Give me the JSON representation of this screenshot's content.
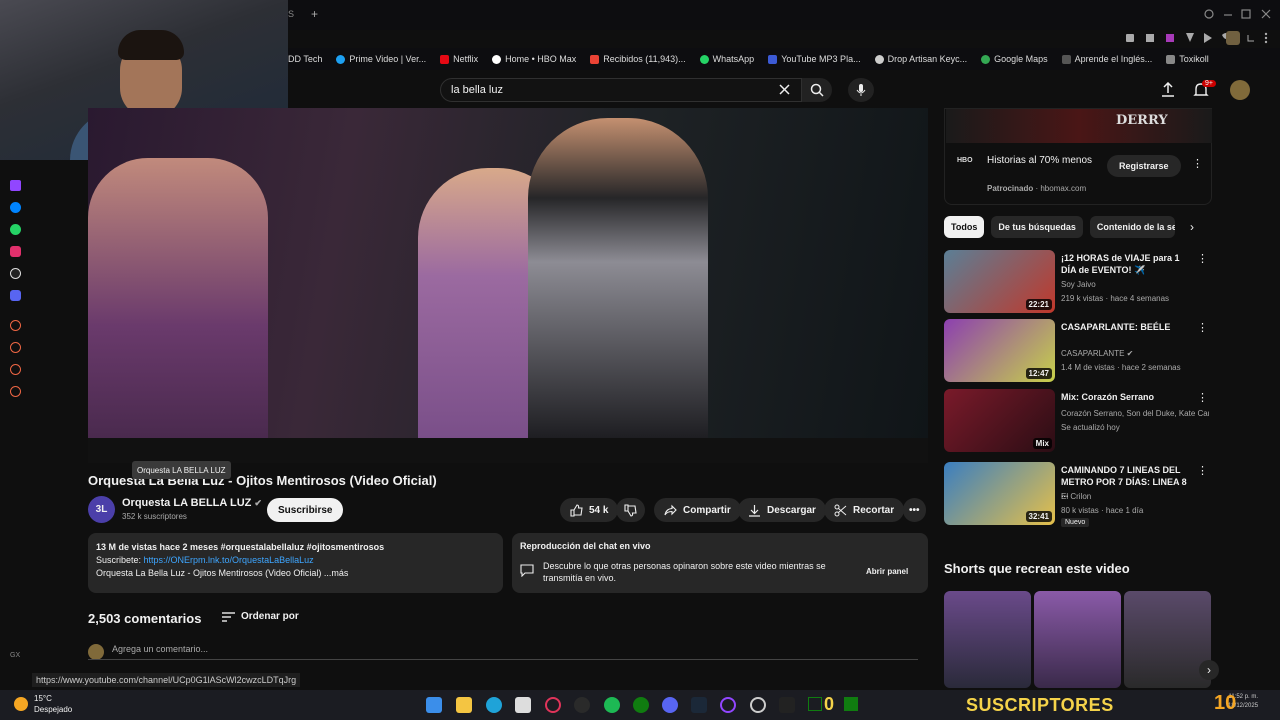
{
  "browser": {
    "tab_fragment": "S",
    "bookmarks": [
      {
        "label": "DD Tech",
        "color": "#2f2f2f"
      },
      {
        "label": "Prime Video | Ver...",
        "color": "#1da0f2"
      },
      {
        "label": "Netflix",
        "color": "#e50914"
      },
      {
        "label": "Home • HBO Max",
        "color": "#ffffff"
      },
      {
        "label": "Recibidos (11,943)...",
        "color": "#ea4335"
      },
      {
        "label": "WhatsApp",
        "color": "#25d366"
      },
      {
        "label": "YouTube MP3 Pla...",
        "color": "#3c5ad6"
      },
      {
        "label": "Drop Artisan Keyc...",
        "color": "#cccccc"
      },
      {
        "label": "Google Maps",
        "color": "#34a853"
      },
      {
        "label": "Aprende el Inglés...",
        "color": "#555555"
      },
      {
        "label": "Toxikoll",
        "color": "#888888"
      }
    ],
    "status_url": "https://www.youtube.com/channel/UCp0G1lAScWl2cwzcLDTqJrg"
  },
  "search": {
    "query": "la bella luz",
    "notifications_badge": "9+"
  },
  "video": {
    "title": "Orquesta La Bella Luz - Ojitos Mentirosos (Video Oficial)",
    "tooltip": "Orquesta LA BELLA LUZ",
    "channel_name": "Orquesta LA BELLA LUZ",
    "channel_avatar_text": "3L",
    "subscribers": "352 k suscriptores",
    "subscribe_label": "Suscribirse",
    "likes": "54 k",
    "share_label": "Compartir",
    "download_label": "Descargar",
    "clip_label": "Recortar",
    "description": {
      "line1": "13 M de vistas  hace 2 meses  #orquestalabellaluz #ojitosmentirosos",
      "line2_prefix": "Suscribete: ",
      "line2_link": "https://ONErpm.lnk.to/OrquestaLaBellaLuz",
      "line3": "Orquesta La Bella Luz - Ojitos Mentirosos (Video Oficial)  ...más"
    },
    "chat_replay": {
      "title": "Reproducción del chat en vivo",
      "text": "Descubre lo que otras personas opinaron sobre este video mientras se transmitía en vivo.",
      "button": "Abrir panel"
    },
    "comments_count": "2,503 comentarios",
    "sort_label": "Ordenar por",
    "add_comment_placeholder": "Agrega un comentario..."
  },
  "sidebar": {
    "ad": {
      "brand_art": "DERRY",
      "title": "Historias al 70% menos",
      "sponsor": "Patrocinado",
      "domain": "hbomax.com",
      "button": "Registrarse"
    },
    "chips": [
      "Todos",
      "De tus búsquedas",
      "Contenido de la ser"
    ],
    "recommendations": [
      {
        "title": "¡12 HORAS de VIAJE para 1 DÍA de EVENTO! ✈️",
        "channel": "Soy Jaivo",
        "meta": "219 k vistas · hace 4 semanas",
        "duration": "22:21",
        "color1": "#5b7f96",
        "color2": "#c0382b"
      },
      {
        "title": "CASAPARLANTE: BEÉLE",
        "channel": "CASAPARLANTE",
        "meta": "1.4 M de vistas · hace 2 semanas",
        "duration": "12:47",
        "color1": "#8c3fb0",
        "color2": "#c7d14a"
      },
      {
        "title": "Mix: Corazón Serrano",
        "channel": "Corazón Serrano, Son del Duke, Kate Can...",
        "meta": "Se actualizó hoy",
        "duration": "Mix",
        "color1": "#7a1a2a",
        "color2": "#2a0d14"
      },
      {
        "title": "CAMINANDO 7 LINEAS DEL METRO POR 7 DÍAS: LINEA 8 ...",
        "channel": "El Crilon",
        "meta": "80 k vistas · hace 1 día",
        "badge": "Nuevo",
        "duration": "32:41",
        "color1": "#3a7ec0",
        "color2": "#e5c04a"
      }
    ],
    "shorts_title": "Shorts que recrean este video",
    "shorts_colors": [
      "#6a4a8a",
      "#8a5aa8",
      "#5a4a6a"
    ]
  },
  "taskbar": {
    "temperature": "15°C",
    "weather": "Despejado",
    "overlay_text": "SUSCRIPTORES",
    "overlay_number": "10",
    "xbox_counter": "0",
    "clock_time": "11:52 p. m.",
    "clock_date": "18/12/2025"
  }
}
